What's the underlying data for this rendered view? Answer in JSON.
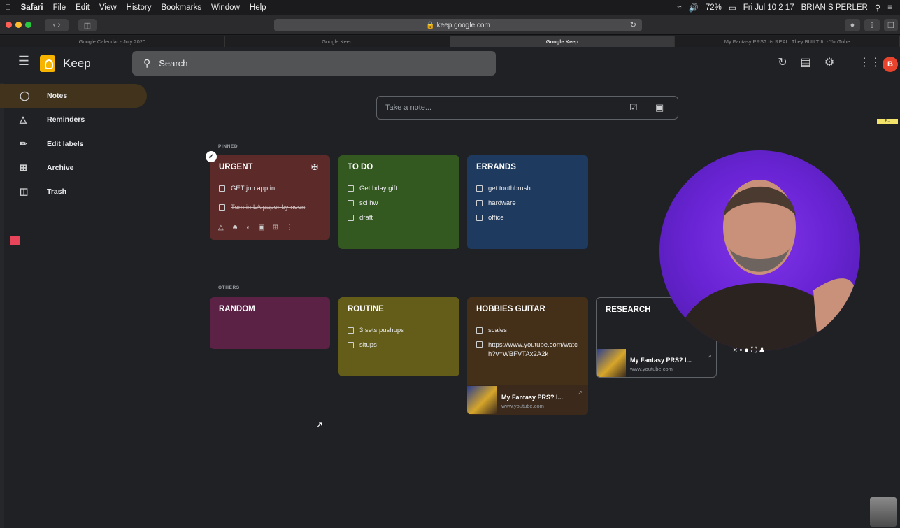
{
  "menubar": {
    "apple": "",
    "items": [
      "Safari",
      "File",
      "Edit",
      "View",
      "History",
      "Bookmarks",
      "Window",
      "Help"
    ],
    "battery": "72%",
    "datetime": "Fri Jul 10 2 17",
    "user": "BRIAN S PERLER"
  },
  "browser": {
    "url": "keep.google.com",
    "tabs": [
      {
        "label": "Google Calendar - July 2020",
        "active": false
      },
      {
        "label": "Google Keep",
        "active": false
      },
      {
        "label": "Google Keep",
        "active": true
      },
      {
        "label": "My Fantasy PRS? Its REAL. They BUILT It. - YouTube",
        "active": false
      }
    ]
  },
  "header": {
    "app_name": "Keep",
    "search_placeholder": "Search",
    "avatar_letter": "B",
    "right_tag": "P..."
  },
  "sidebar": {
    "items": [
      {
        "label": "Notes",
        "icon": "lightbulb-icon",
        "active": true
      },
      {
        "label": "Reminders",
        "icon": "bell-icon",
        "active": false
      },
      {
        "label": "Edit labels",
        "icon": "pencil-icon",
        "active": false
      },
      {
        "label": "Archive",
        "icon": "archive-icon",
        "active": false
      },
      {
        "label": "Trash",
        "icon": "trash-icon",
        "active": false
      }
    ]
  },
  "take_note": {
    "placeholder": "Take a note..."
  },
  "sections": {
    "pinned": "PINNED",
    "others": "OTHERS"
  },
  "notes": {
    "urgent": {
      "title": "URGENT",
      "color": "#5c2b29",
      "items": [
        "GET job app in",
        "Turn in LA paper by noon"
      ],
      "checked": [
        false,
        true
      ]
    },
    "todo": {
      "title": "TO DO",
      "color": "#345920",
      "items": [
        "Get bday gift",
        "sci hw",
        "draft"
      ]
    },
    "errands": {
      "title": "ERRANDS",
      "color": "#1e3a5f",
      "items": [
        "get toothbrush",
        "hardware",
        "office"
      ]
    },
    "random": {
      "title": "RANDOM",
      "color": "#5b2245"
    },
    "routine": {
      "title": "ROUTINE",
      "color": "#635d19",
      "items": [
        "3 sets pushups",
        "situps"
      ]
    },
    "hobbies": {
      "title": "HOBBIES GUITAR",
      "color": "#442f19",
      "items": [
        "scales"
      ],
      "link_text": "https://www.youtube.com/watch?v=WBFVTAx2A2k",
      "link_title": "My Fantasy PRS? I...",
      "link_domain": "www.youtube.com"
    },
    "research": {
      "title": "RESEARCH",
      "color": "#202124",
      "link_title": "My Fantasy PRS? I...",
      "link_domain": "www.youtube.com"
    }
  }
}
